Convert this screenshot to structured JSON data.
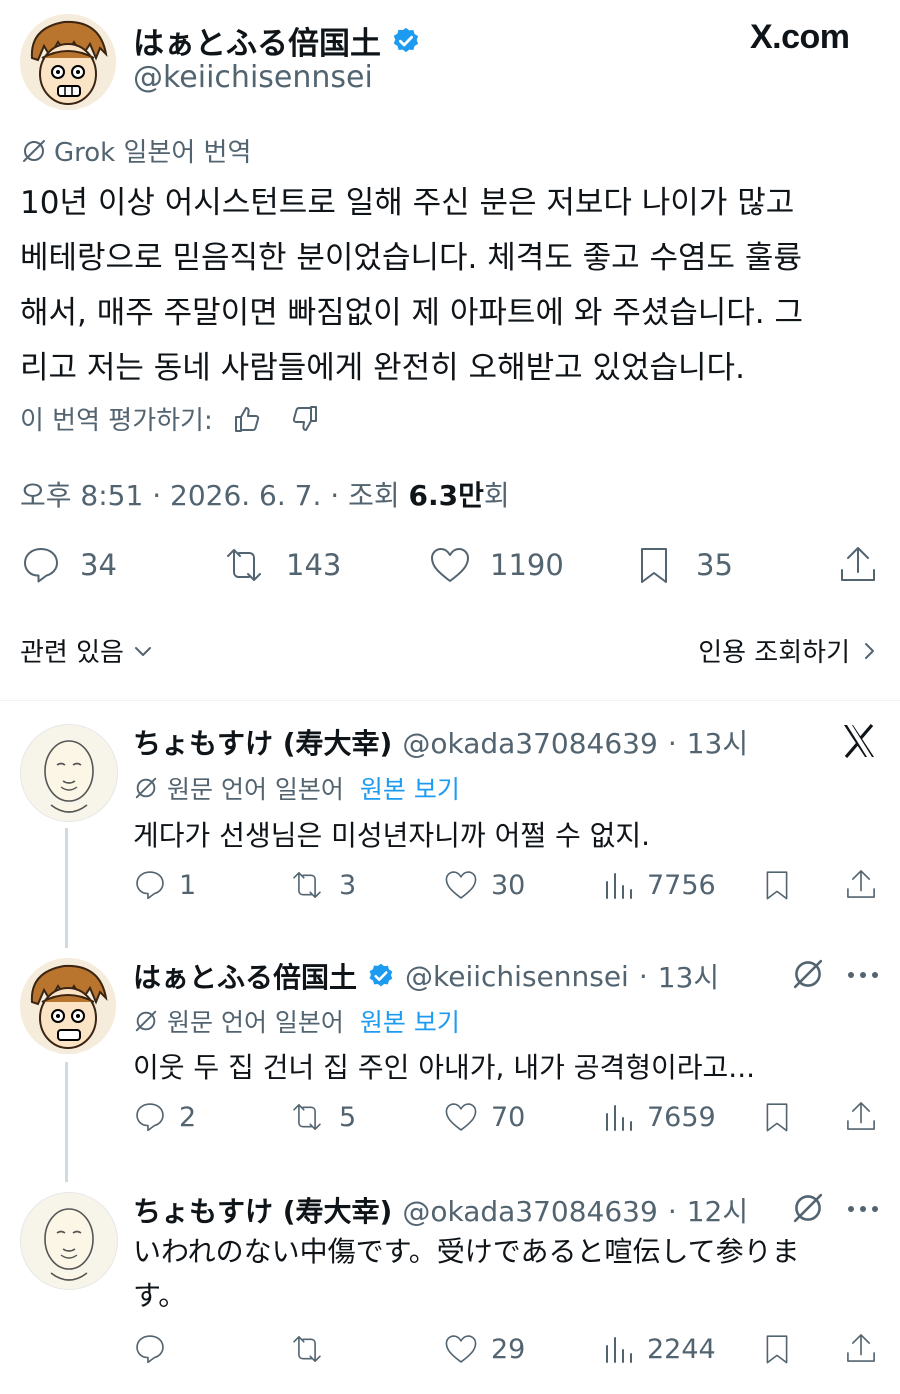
{
  "site_label": "X.com",
  "main_post": {
    "display_name": "はぁとふる倍国土",
    "handle": "@keiichisennsei",
    "translation_label": "Grok 일본어 번역",
    "text_lines": [
      "10년 이상 어시스턴트로 일해 주신 분은 저보다 나이가 많고",
      "베테랑으로 믿음직한 분이었습니다. 체격도 좋고 수염도 훌륭",
      "해서, 매주 주말이면 빠짐없이 제 아파트에 와 주셨습니다. 그",
      "리고 저는 동네 사람들에게 완전히 오해받고 있었습니다."
    ],
    "rate_label": "이 번역 평가하기:",
    "timestamp": "오후 8:51 · 2026. 6. 7. · 조회 ",
    "views_value": "6.3만",
    "views_suffix": "회",
    "replies": "34",
    "reposts": "143",
    "likes": "1190",
    "bookmarks": "35"
  },
  "related": {
    "label": "관련 있음",
    "quotes_label": "인용 조회하기"
  },
  "replies": [
    {
      "display_name": "ちょもすけ (寿大幸)",
      "handle": "@okada37084639",
      "time": "13시",
      "lang_label": "원문 언어 일본어",
      "original_link": "원본 보기",
      "text_lines": [
        "게다가 선생님은 미성년자니까 어쩔 수 없지."
      ],
      "replies": "1",
      "reposts": "3",
      "likes": "30",
      "views": "7756"
    },
    {
      "display_name": "はぁとふる倍国土",
      "handle": "@keiichisennsei",
      "time": "13시",
      "lang_label": "원문 언어 일본어",
      "original_link": "원본 보기",
      "text_lines": [
        "이웃 두 집 건너 집 주인 아내가, 내가 공격형이라고..."
      ],
      "replies": "2",
      "reposts": "5",
      "likes": "70",
      "views": "7659"
    },
    {
      "display_name": "ちょもすけ (寿大幸)",
      "handle": "@okada37084639",
      "time": "12시",
      "text_lines": [
        "いわれのない中傷です。受けであると喧伝して参りま",
        "す。"
      ],
      "replies": "",
      "reposts": "",
      "likes": "29",
      "views": "2244"
    }
  ],
  "colors": {
    "text": "#0f1419",
    "secondary": "#536471",
    "accent": "#1d9bf0",
    "divider": "#eff3f4"
  }
}
